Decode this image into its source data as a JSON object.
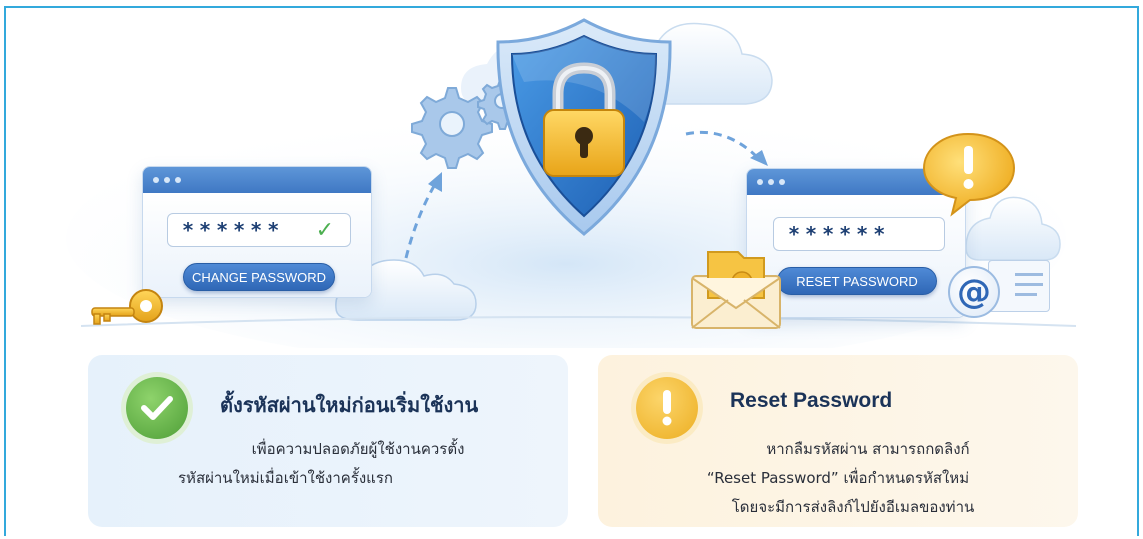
{
  "illustration": {
    "left_window": {
      "password_mask": "******",
      "button_label": "CHANGE PASSWORD"
    },
    "right_window": {
      "password_mask": "******",
      "button_label": "RESET PASSWORD"
    },
    "email_symbol": "@"
  },
  "cards": {
    "left": {
      "title": "ตั้งรหัสผ่านใหม่ก่อนเริ่มใช้งาน",
      "line1": "เพื่อความปลอดภัยผู้ใช้งานควรตั้ง",
      "line2": "รหัสผ่านใหม่เมื่อเข้าใช้งาครั้งแรก"
    },
    "right": {
      "title": "Reset Password",
      "line1": "หากลืมรหัสผ่าน สามารถกดลิงก์",
      "line2": "“Reset Password” เพื่อกำหนดรหัสใหม่",
      "line3": "โดยจะมีการส่งลิงก์ไปยังอีเมลของท่าน"
    }
  },
  "colors": {
    "frame_border": "#33a9dc",
    "button_blue": "#3a72c0",
    "check_green": "#4e9e37",
    "warning_yellow": "#ecae22"
  }
}
